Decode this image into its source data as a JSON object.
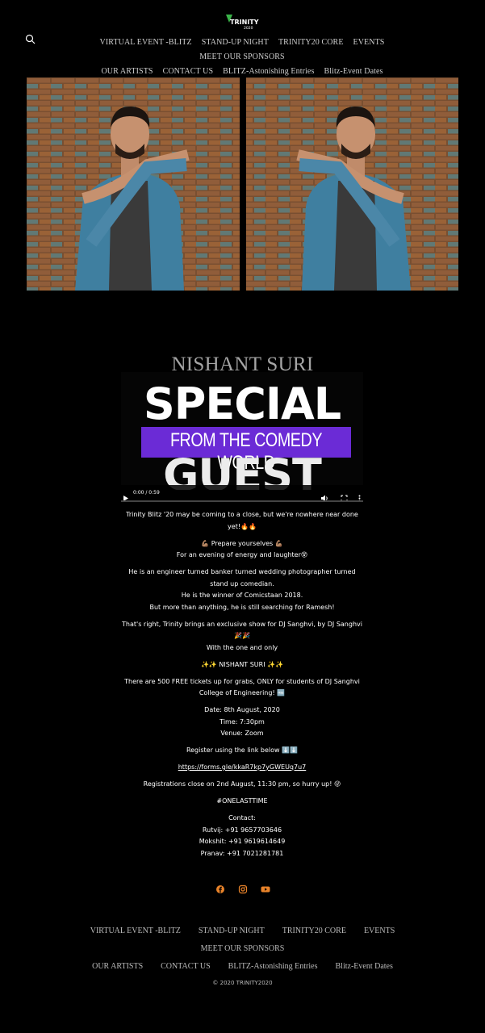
{
  "header": {
    "logo_text": "TRINITY",
    "logo_sub": "2020"
  },
  "nav": {
    "items": [
      "VIRTUAL EVENT -BLITZ",
      "STAND-UP NIGHT",
      "TRINITY20 CORE",
      "EVENTS",
      "MEET OUR SPONSORS",
      "OUR ARTISTS",
      "CONTACT US",
      "BLITZ-Astonishing Entries",
      "Blitz-Event Dates"
    ]
  },
  "page": {
    "title": "NISHANT SURI"
  },
  "video": {
    "line1": "SPECIAL",
    "band": "FROM THE COMEDY WORLD",
    "line2": "GUEST",
    "time": "0:00 / 0:59",
    "progress": 0
  },
  "content": {
    "p1": "Trinity Blitz '20 may be coming to a close, but we're nowhere near done yet!🔥🔥",
    "p2a": "💪🏽 Prepare yourselves 💪🏽",
    "p2b": "For an evening of energy and laughter😵",
    "p3a": "He is an engineer turned banker turned wedding photographer turned stand up comedian.",
    "p3b": "He is the winner of Comicstaan 2018.",
    "p3c": "But more than anything, he is still searching for Ramesh!",
    "p4a": "That's right, Trinity brings an exclusive show for DJ Sanghvi, by DJ Sanghvi🎉🎉",
    "p4b": "With the one and only",
    "p5": "✨✨ NISHANT SURI ✨✨",
    "p6": "There are 500 FREE tickets up for grabs, ONLY for students of DJ Sanghvi College of Engineering! 🆓",
    "p7a": "Date: 8th August, 2020",
    "p7b": "Time: 7:30pm",
    "p7c": "Venue: Zoom",
    "p8": "Register using the link below ⬇️⬇️",
    "link": "https://forms.gle/kkaR7kp7yGWEUq7u7",
    "p9": "Registrations close on 2nd August, 11:30 pm, so hurry up! 😜",
    "p10": "#ONELASTTIME",
    "contact_label": "Contact:",
    "contact1": "Rutvij: +91 9657703646",
    "contact2": "Mokshit: +91 9619614649",
    "contact3": "Pranav: +91 7021281781"
  },
  "social": {
    "icons": [
      "facebook-icon",
      "instagram-icon",
      "youtube-icon"
    ],
    "accent": "#e8832a"
  },
  "footer": {
    "items": [
      "VIRTUAL EVENT -BLITZ",
      "STAND-UP NIGHT",
      "TRINITY20 CORE",
      "EVENTS",
      "MEET OUR SPONSORS",
      "OUR ARTISTS",
      "CONTACT US",
      "BLITZ-Astonishing Entries",
      "Blitz-Event Dates"
    ],
    "copyright": "© 2020  TRINITY2020"
  }
}
